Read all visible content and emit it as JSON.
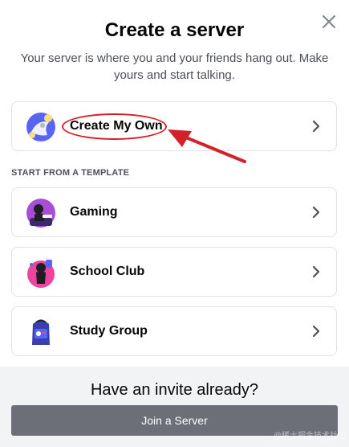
{
  "modal": {
    "title": "Create a server",
    "subtitle": "Your server is where you and your friends hang out. Make yours and start talking.",
    "close_icon": "close-icon"
  },
  "create_own": {
    "label": "Create My Own",
    "icon": "create-server-illustration"
  },
  "templates": {
    "header": "START FROM A TEMPLATE",
    "items": [
      {
        "label": "Gaming",
        "icon": "gaming-illustration"
      },
      {
        "label": "School Club",
        "icon": "school-club-illustration"
      },
      {
        "label": "Study Group",
        "icon": "study-group-illustration"
      }
    ]
  },
  "footer": {
    "title": "Have an invite already?",
    "join_label": "Join a Server"
  },
  "watermark": "@稀土掘金技术社区",
  "colors": {
    "annotation": "#d3202a",
    "join_button": "#6d6f78",
    "footer_bg": "#f2f3f5",
    "border": "#e1e2e4"
  }
}
